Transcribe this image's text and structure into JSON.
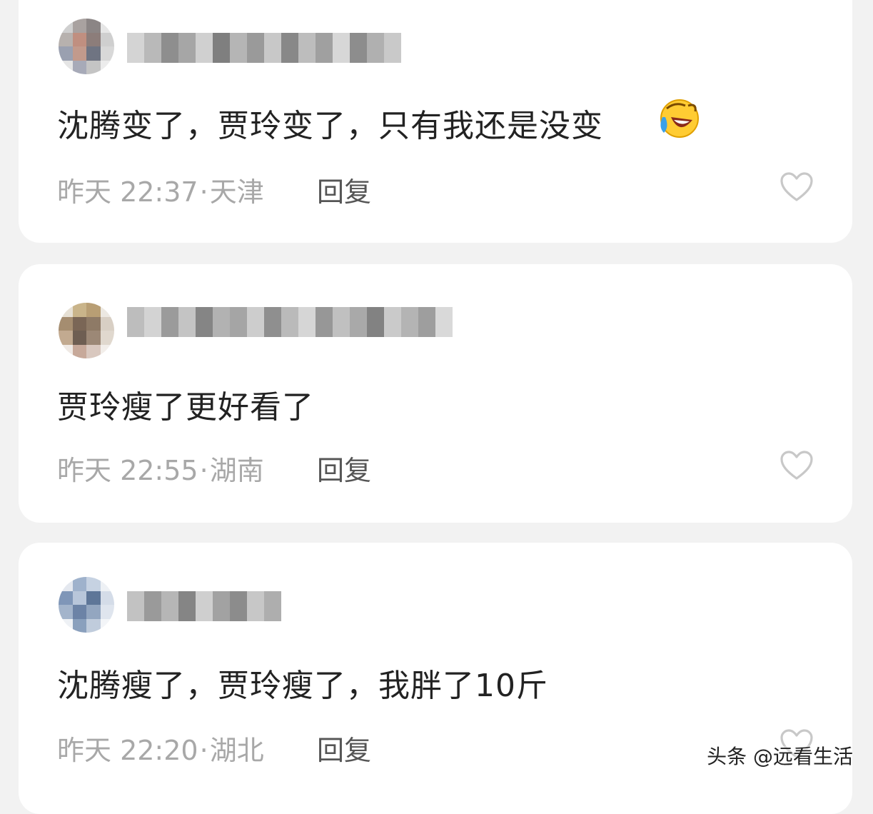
{
  "comments": [
    {
      "text": "沈腾变了，贾玲变了，只有我还是没变",
      "emoji": "rofl-emoji",
      "time": "昨天 22:37",
      "separator": "·",
      "location": "天津",
      "reply_label": "回复",
      "like_icon": "heart-outline-icon"
    },
    {
      "text": "贾玲瘦了更好看了",
      "time": "昨天 22:55",
      "separator": "·",
      "location": "湖南",
      "reply_label": "回复",
      "like_icon": "heart-outline-icon"
    },
    {
      "text": "沈腾瘦了，贾玲瘦了，我胖了10斤",
      "time": "昨天 22:20",
      "separator": "·",
      "location": "湖北",
      "reply_label": "回复",
      "like_icon": "heart-outline-icon"
    }
  ],
  "watermark": "头条 @远看生活",
  "colors": {
    "background": "#f2f2f2",
    "card": "#ffffff",
    "text": "#222222",
    "meta": "#a8a8a8",
    "reply": "#555555"
  }
}
